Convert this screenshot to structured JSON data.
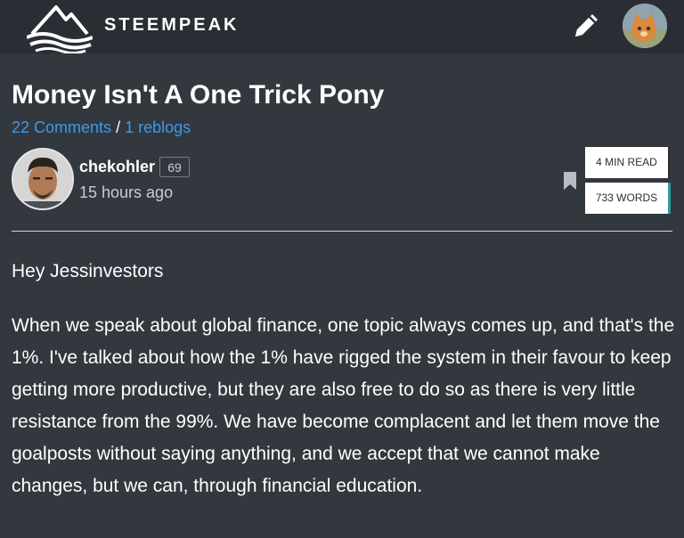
{
  "header": {
    "logo_text": "STEEMPEAK",
    "logo_icon": "steempeak-mountain-logo",
    "edit_icon": "pencil-icon",
    "user_avatar": "user-avatar"
  },
  "post": {
    "title": "Money Isn't A One Trick Pony",
    "comments_label": "22 Comments",
    "separator": "/",
    "reblogs_label": "1 reblogs",
    "author": {
      "name": "chekohler",
      "reputation": "69",
      "time_ago": "15 hours ago"
    },
    "stats": {
      "read_time": "4 MIN READ",
      "word_count": "733 WORDS"
    },
    "bookmark_icon": "bookmark-icon",
    "greeting": "Hey Jessinvestors",
    "paragraph": "When we speak about global finance, one topic always comes up, and that's the 1%. I've talked about how the 1% have rigged the system in their favour to keep getting more productive, but they are also free to do so as there is very little resistance from the 99%. We have become complacent and let them move the goalposts without saying anything, and we accept that we cannot make changes, but we can, through financial education."
  },
  "colors": {
    "background": "#33373e",
    "header_background": "#2a2e34",
    "link": "#3d9ae8",
    "accent": "#2f9aa3",
    "text": "#ffffff"
  }
}
